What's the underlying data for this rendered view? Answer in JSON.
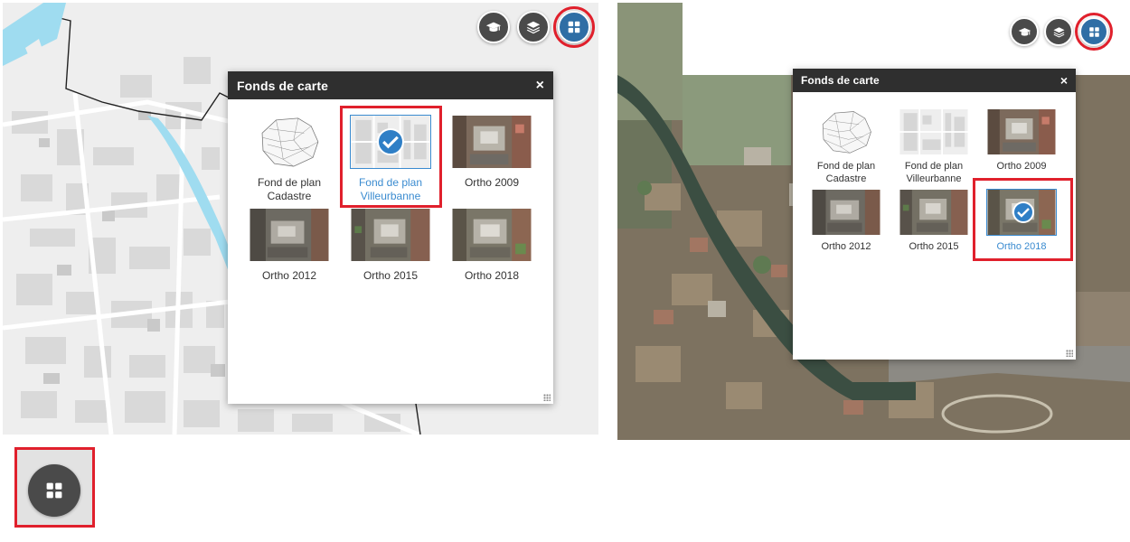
{
  "left_view": {
    "panel_title": "Fonds de carte",
    "close_label": "×",
    "basemaps": [
      {
        "label_line1": "Fond de plan",
        "label_line2": "Cadastre",
        "thumb": "cadastre",
        "selected": false
      },
      {
        "label_line1": "Fond de plan",
        "label_line2": "Villeurbanne",
        "thumb": "plan",
        "selected": true
      },
      {
        "label_line1": "Ortho 2009",
        "label_line2": "",
        "thumb": "ortho-a",
        "selected": false
      },
      {
        "label_line1": "Ortho 2012",
        "label_line2": "",
        "thumb": "ortho-b",
        "selected": false
      },
      {
        "label_line1": "Ortho 2015",
        "label_line2": "",
        "thumb": "ortho-c",
        "selected": false
      },
      {
        "label_line1": "Ortho 2018",
        "label_line2": "",
        "thumb": "ortho-d",
        "selected": false
      }
    ],
    "toolbar": [
      "graduation-cap-icon",
      "layers-icon",
      "basemap-grid-icon"
    ]
  },
  "right_view": {
    "panel_title": "Fonds de carte",
    "close_label": "×",
    "basemaps": [
      {
        "label_line1": "Fond de plan",
        "label_line2": "Cadastre",
        "thumb": "cadastre",
        "selected": false
      },
      {
        "label_line1": "Fond de plan",
        "label_line2": "Villeurbanne",
        "thumb": "plan",
        "selected": false
      },
      {
        "label_line1": "Ortho 2009",
        "label_line2": "",
        "thumb": "ortho-a",
        "selected": false
      },
      {
        "label_line1": "Ortho 2012",
        "label_line2": "",
        "thumb": "ortho-b",
        "selected": false
      },
      {
        "label_line1": "Ortho 2015",
        "label_line2": "",
        "thumb": "ortho-c",
        "selected": false
      },
      {
        "label_line1": "Ortho 2018",
        "label_line2": "",
        "thumb": "ortho-d",
        "selected": true
      }
    ],
    "toolbar": [
      "graduation-cap-icon",
      "layers-icon",
      "basemap-grid-icon"
    ]
  },
  "colors": {
    "highlight_red": "#e0202c",
    "selected_blue": "#3a8bd0",
    "panel_header": "#2f2f2f",
    "active_button": "#2f6ea5",
    "river": "#9fdcf0"
  }
}
